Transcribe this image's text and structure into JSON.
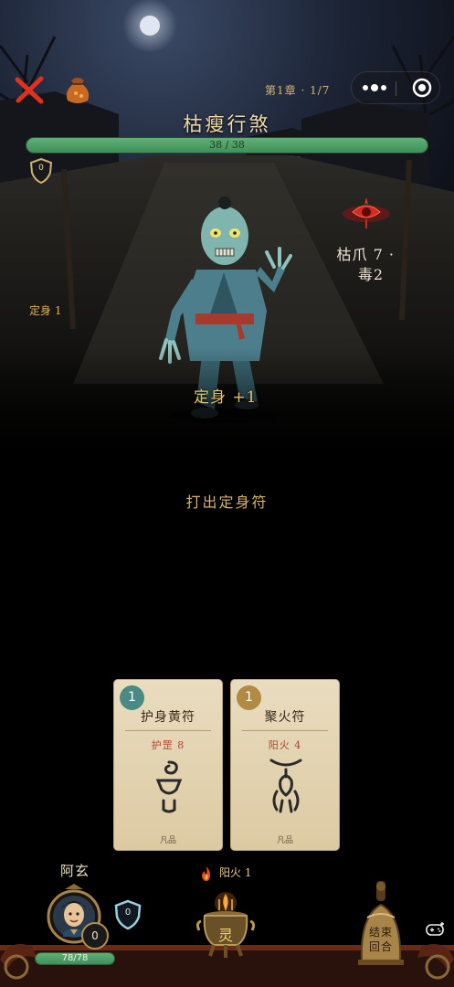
{
  "header": {
    "close_icon": "close-x-icon",
    "bag_icon": "pouch-bag-icon",
    "chapter_label": "第1章 · 1/7",
    "capsule_more_icon": "more-dots-icon",
    "capsule_target_icon": "target-circle-icon"
  },
  "enemy": {
    "name": "枯瘦行煞",
    "hp_text": "38 / 38",
    "hp_current": 38,
    "hp_max": 38,
    "block": "0",
    "intent_line1": "枯爪 7 ·",
    "intent_line2": "毒2",
    "status_left": "定身 1",
    "floating_text": "定身 +1"
  },
  "log": {
    "action": "打出定身符"
  },
  "hand": [
    {
      "cost": "1",
      "name": "护身黄符",
      "effect": "护罡 8",
      "rarity": "凡品",
      "color": "#4a8a84"
    },
    {
      "cost": "1",
      "name": "聚火符",
      "effect": "阳火 4",
      "rarity": "凡品",
      "color": "#b18a44"
    }
  ],
  "player": {
    "name": "阿玄",
    "block": "0",
    "shield": "0",
    "hp_text": "78/78",
    "hp_current": 78,
    "hp_max": 78
  },
  "energy": {
    "label": "阳火 1",
    "censer_char": "灵"
  },
  "end_turn": {
    "label_line1": "结束",
    "label_line2": "回合"
  },
  "colors": {
    "hp_green": "#4fa066",
    "gold_text": "#d8b46a",
    "red_text": "#b0402e"
  }
}
